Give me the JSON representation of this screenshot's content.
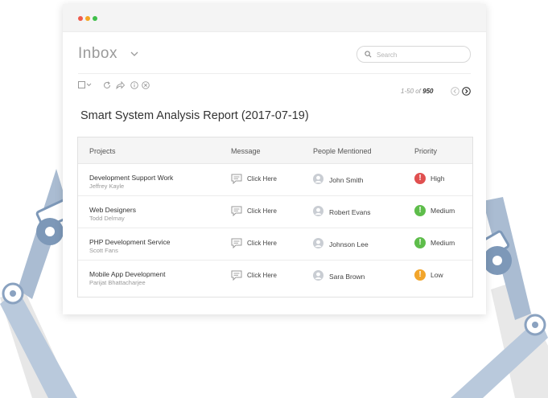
{
  "window": {
    "traffic_lights": {
      "red": "#ef5b4c",
      "yellow": "#f4a623",
      "green": "#3fbf4a"
    }
  },
  "header": {
    "title": "Inbox",
    "search_placeholder": "Search"
  },
  "toolbar": {
    "icons": [
      "select-checkbox-icon",
      "refresh-icon",
      "forward-icon",
      "info-icon",
      "close-icon"
    ]
  },
  "pagination": {
    "range": "1-50 of",
    "total": "950"
  },
  "report": {
    "title": "Smart System Analysis Report (2017-07-19)",
    "columns": [
      "Projects",
      "Message",
      "People Mentioned",
      "Priority"
    ],
    "rows": [
      {
        "project": "Development Support Work",
        "owner": "Jeffrey Kayle",
        "message": "Click Here",
        "person": "John Smith",
        "priority": "High",
        "priority_color": "#e05050",
        "priority_symbol": "!"
      },
      {
        "project": "Web Designers",
        "owner": "Todd Delmay",
        "message": "Click Here",
        "person": "Robert Evans",
        "priority": "Medium",
        "priority_color": "#5ebd4b",
        "priority_symbol": "!"
      },
      {
        "project": "PHP Development Service",
        "owner": "Scott Fans",
        "message": "Click Here",
        "person": "Johnson Lee",
        "priority": "Medium",
        "priority_color": "#5ebd4b",
        "priority_symbol": "!"
      },
      {
        "project": "Mobile App Development",
        "owner": "Parijat Bhattacharjee",
        "message": "Click Here",
        "person": "Sara Brown",
        "priority": "Low",
        "priority_color": "#f2a52b",
        "priority_symbol": "!"
      }
    ]
  },
  "colors": {
    "robot_arm": "#aebfd4",
    "robot_arm_dark": "#7d98b8",
    "robot_shadow": "#e6e6e6"
  }
}
